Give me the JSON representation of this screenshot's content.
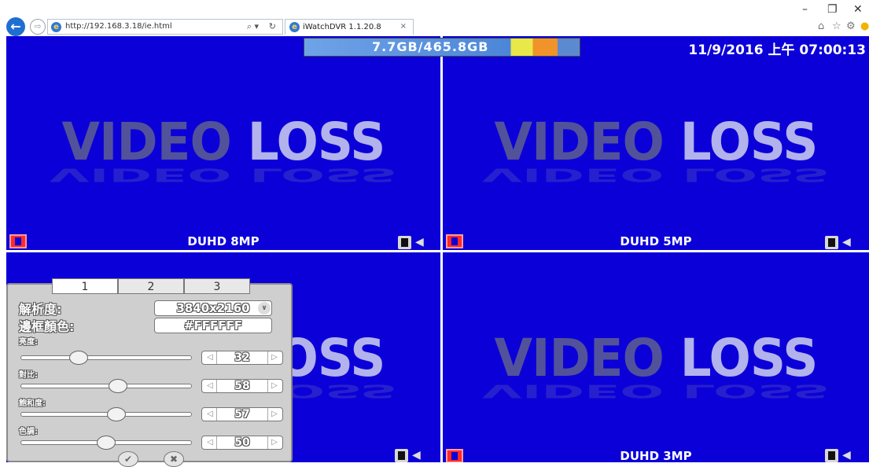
{
  "browser": {
    "url": "http://192.168.3.18/ie.html",
    "tab_title": "iWatchDVR 1.1.20.8",
    "tab_close": "×",
    "search_glyph": "⌕ ▾",
    "refresh_glyph": "↻",
    "window_controls": [
      "–",
      "❐",
      "✕"
    ],
    "toolbar_icons": [
      "home-icon",
      "star-icon",
      "gear-icon",
      "smiley-icon"
    ]
  },
  "dvr": {
    "hdd_usage": "7.7GB/465.8GB",
    "clock": "11/9/2016 上午 07:00:13",
    "video_loss_word1": "VIDEO",
    "video_loss_word2": "LOSS",
    "cameras": [
      {
        "label": "DUHD 8MP"
      },
      {
        "label": "DUHD 5MP"
      },
      {
        "label": ""
      },
      {
        "label": "DUHD 3MP"
      }
    ],
    "colors": {
      "cell_bg": "#0b00d8",
      "panel_bg": "#cfcfcf"
    }
  },
  "panel": {
    "tabs": [
      "1",
      "2",
      "3"
    ],
    "resolution_label": "解析度:",
    "resolution_value": "3840x2160",
    "border_color_label": "邊框顏色:",
    "border_color_value": "#FFFFFF",
    "sliders": [
      {
        "label": "亮度:",
        "value": "32"
      },
      {
        "label": "對比:",
        "value": "58"
      },
      {
        "label": "飽和度:",
        "value": "57"
      },
      {
        "label": "色調:",
        "value": "50"
      }
    ],
    "slider_levels": [
      0.32,
      0.58,
      0.57,
      0.5
    ]
  }
}
